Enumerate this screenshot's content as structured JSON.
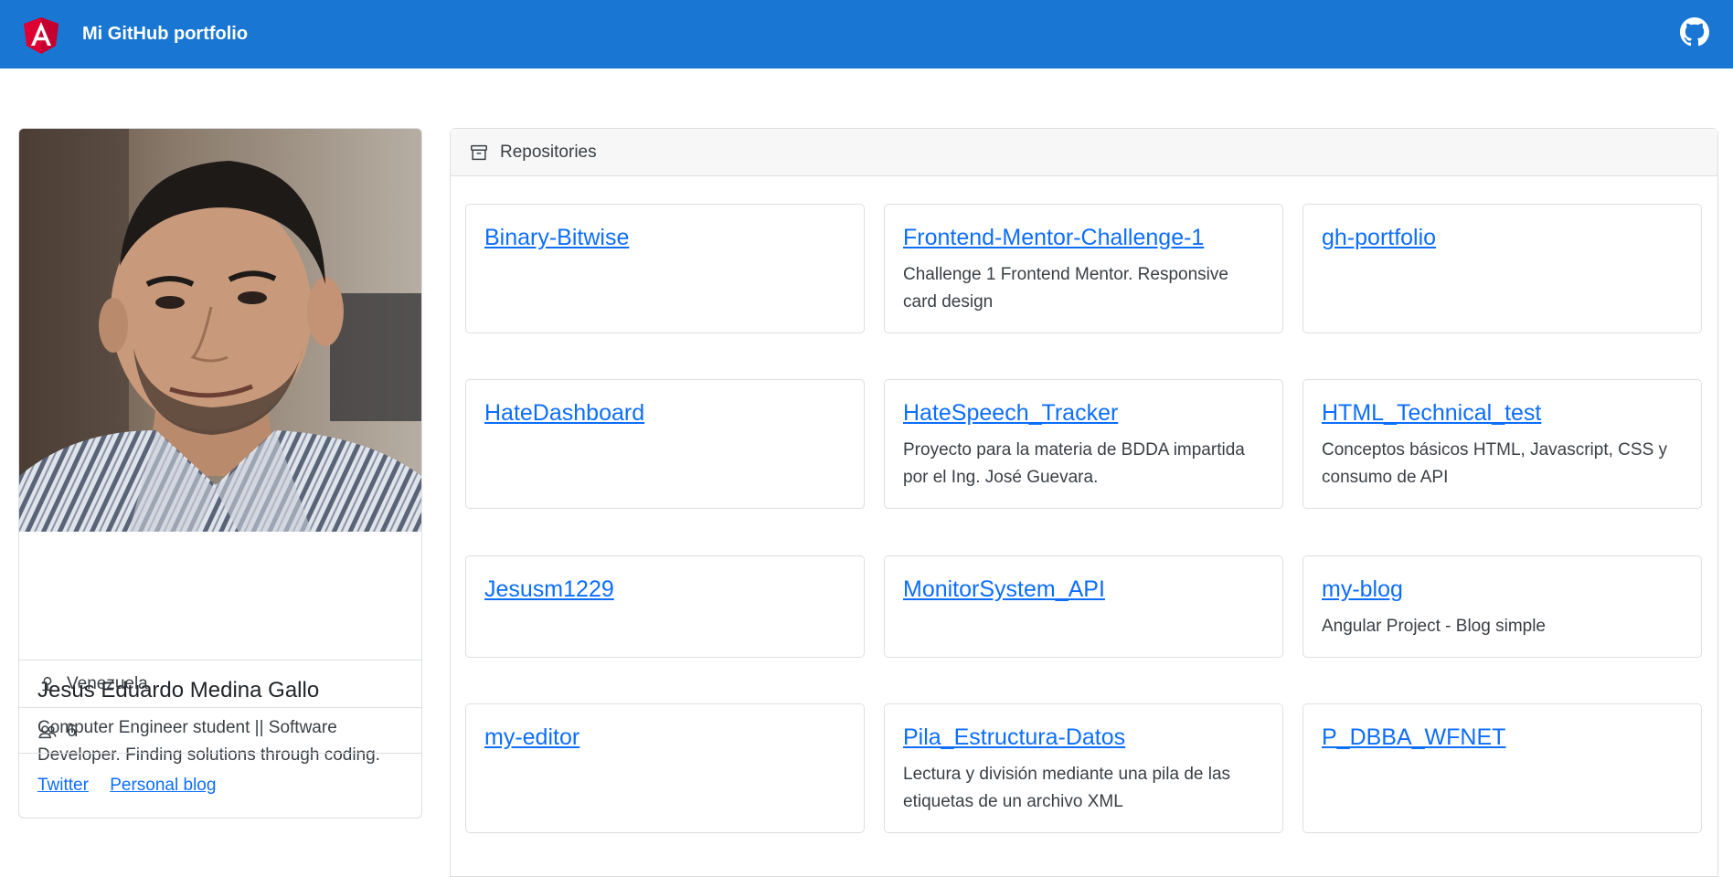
{
  "navbar": {
    "title": "Mi GitHub portfolio",
    "logo_icon": "angular-logo-icon",
    "github_icon": "github-icon",
    "bg_color": "#1976d2"
  },
  "profile": {
    "photo": "profile-photo",
    "name": "Jesus Eduardo Medina Gallo",
    "bio": "Computer Engineer student || Software Developer. Finding solutions through coding.",
    "location": "Venezuela",
    "followers": "6",
    "links": [
      "Twitter",
      "Personal blog"
    ]
  },
  "repositories": {
    "header": "Repositories",
    "items": [
      {
        "name": "Binary-Bitwise",
        "description": ""
      },
      {
        "name": "Frontend-Mentor-Challenge-1",
        "description": "Challenge 1 Frontend Mentor. Responsive card design"
      },
      {
        "name": "gh-portfolio",
        "description": ""
      },
      {
        "name": "HateDashboard",
        "description": ""
      },
      {
        "name": "HateSpeech_Tracker",
        "description": "Proyecto para la materia de BDDA impartida por el Ing. José Guevara."
      },
      {
        "name": "HTML_Technical_test",
        "description": "Conceptos básicos HTML, Javascript, CSS y consumo de API"
      },
      {
        "name": "Jesusm1229",
        "description": ""
      },
      {
        "name": "MonitorSystem_API",
        "description": ""
      },
      {
        "name": "my-blog",
        "description": "Angular Project - Blog simple"
      },
      {
        "name": "my-editor",
        "description": ""
      },
      {
        "name": "Pila_Estructura-Datos",
        "description": "Lectura y división mediante una pila de las etiquetas de un archivo XML"
      },
      {
        "name": "P_DBBA_WFNET",
        "description": ""
      }
    ]
  }
}
